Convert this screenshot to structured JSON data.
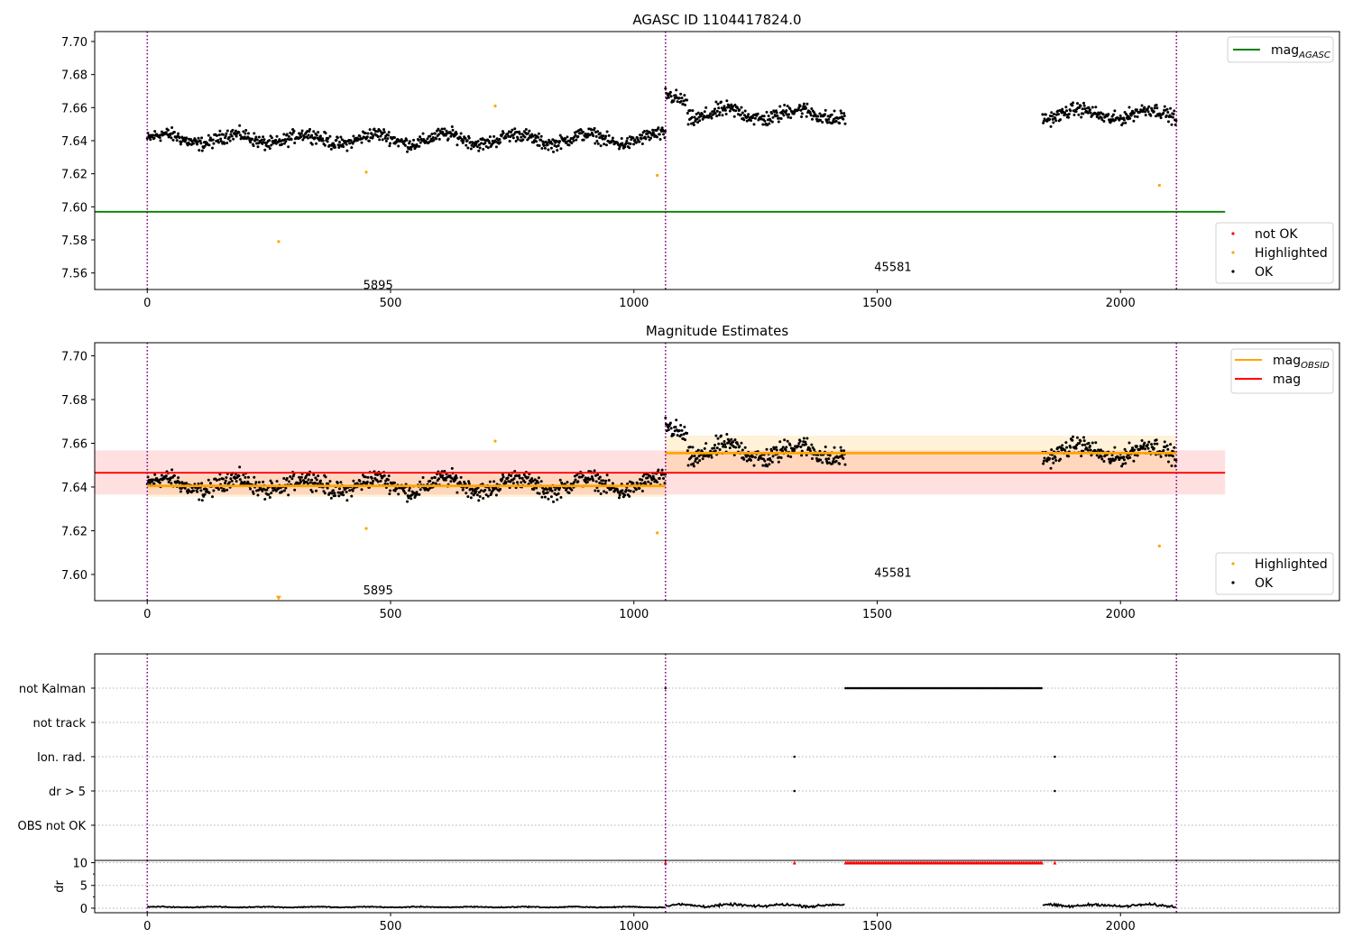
{
  "figure": {
    "title": "AGASC ID 1104417824.0"
  },
  "chart_data": [
    {
      "type": "scatter",
      "title": "",
      "xlim": [
        -108,
        2450
      ],
      "ylim": [
        7.55,
        7.706
      ],
      "xticks": [
        0,
        500,
        1000,
        1500,
        2000
      ],
      "yticks": [
        7.56,
        7.58,
        7.6,
        7.62,
        7.64,
        7.66,
        7.68,
        7.7
      ],
      "grid": false,
      "obs_boundaries": [
        0,
        1065,
        2115
      ],
      "obs_labels": [
        {
          "text": "5895",
          "x": 530,
          "y": 7.553
        },
        {
          "text": "45581",
          "x": 1588,
          "y": 7.564
        }
      ],
      "mag_agasc": {
        "value": 7.597,
        "x_range": [
          -108,
          2215
        ],
        "color": "#008000"
      },
      "legend_top": {
        "placement": "upper right",
        "entries": [
          {
            "label": "mag",
            "subscript": "AGASC",
            "color": "#008000",
            "kind": "line"
          }
        ]
      },
      "legend_bottom": {
        "placement": "lower right",
        "entries": [
          {
            "label": "not OK",
            "color": "#ff0000",
            "kind": "dot"
          },
          {
            "label": "Highlighted",
            "color": "#ffa500",
            "kind": "dot"
          },
          {
            "label": "OK",
            "color": "#000000",
            "kind": "dot"
          }
        ]
      },
      "highlighted_points": [
        [
          270,
          7.579
        ],
        [
          450,
          7.621
        ],
        [
          715,
          7.661
        ],
        [
          1048,
          7.619
        ],
        [
          2080,
          7.613
        ]
      ],
      "segments": [
        {
          "x_range": [
            0,
            1065
          ],
          "mean": 7.641,
          "amp": 0.006
        },
        {
          "x_range": [
            1065,
            1435
          ],
          "mean": 7.656,
          "amp": 0.007
        },
        {
          "x_range": [
            1840,
            2115
          ],
          "mean": 7.656,
          "amp": 0.006
        }
      ]
    },
    {
      "type": "scatter",
      "title": "Magnitude Estimates",
      "xlim": [
        -108,
        2450
      ],
      "ylim": [
        7.588,
        7.706
      ],
      "xticks": [
        0,
        500,
        1000,
        1500,
        2000
      ],
      "yticks": [
        7.6,
        7.62,
        7.64,
        7.66,
        7.68,
        7.7
      ],
      "grid": false,
      "obs_boundaries": [
        0,
        1065,
        2115
      ],
      "obs_labels": [
        {
          "text": "5895",
          "x": 530,
          "y": 7.593
        },
        {
          "text": "45581",
          "x": 1588,
          "y": 7.601
        }
      ],
      "mag": {
        "value": 7.6465,
        "band": [
          7.6365,
          7.6568
        ],
        "x_range": [
          -108,
          2215
        ],
        "color": "#ff0000"
      },
      "mag_obsid": [
        {
          "x_range": [
            0,
            1065
          ],
          "value": 7.6405,
          "band": [
            7.6355,
            7.6455
          ]
        },
        {
          "x_range": [
            1065,
            2115
          ],
          "value": 7.6555,
          "band": [
            7.6465,
            7.6635
          ]
        }
      ],
      "legend_top": {
        "placement": "upper right",
        "entries": [
          {
            "label": "mag",
            "subscript": "OBSID",
            "color": "#ffa500",
            "kind": "line"
          },
          {
            "label": "mag",
            "subscript": "",
            "color": "#ff0000",
            "kind": "line"
          }
        ]
      },
      "legend_bottom": {
        "placement": "lower right",
        "entries": [
          {
            "label": "Highlighted",
            "color": "#ffa500",
            "kind": "dot"
          },
          {
            "label": "OK",
            "color": "#000000",
            "kind": "dot"
          }
        ]
      },
      "highlighted_points": [
        [
          270,
          7.589
        ],
        [
          450,
          7.621
        ],
        [
          715,
          7.661
        ],
        [
          1048,
          7.619
        ],
        [
          2080,
          7.613
        ]
      ]
    },
    {
      "type": "scatter",
      "title": "",
      "xlim": [
        -108,
        2450
      ],
      "categories": [
        "not Kalman",
        "not track",
        "Ion. rad.",
        "dr > 5",
        "OBS not OK"
      ],
      "grid": true,
      "obs_boundaries": [
        0,
        1065,
        2115
      ],
      "flags": {
        "not Kalman": {
          "runs": [
            [
              1435,
              1840
            ]
          ],
          "points": [
            1065
          ]
        },
        "not track": {
          "runs": [],
          "points": []
        },
        "Ion. rad.": {
          "runs": [],
          "points": [
            1330,
            1865
          ]
        },
        "dr > 5": {
          "runs": [],
          "points": [
            1330,
            1865
          ]
        },
        "OBS not OK": {
          "runs": [],
          "points": []
        }
      }
    },
    {
      "type": "line",
      "title": "",
      "xlim": [
        -108,
        2450
      ],
      "ylim": [
        -1,
        10.5
      ],
      "ylabel": "dr",
      "yticks": [
        0,
        5,
        10
      ],
      "xticks": [
        0,
        500,
        1000,
        1500,
        2000
      ],
      "grid": true,
      "obs_boundaries": [
        0,
        1065,
        2115
      ],
      "clipped_points": {
        "value": 10,
        "runs": [
          [
            1435,
            1840
          ]
        ],
        "points": [
          1065,
          1330,
          1865
        ]
      },
      "segments": [
        {
          "x_range": [
            0,
            1065
          ],
          "base": 0.25,
          "amp": 0.15
        },
        {
          "x_range": [
            1065,
            1435
          ],
          "base": 0.6,
          "amp": 0.4
        },
        {
          "x_range": [
            1840,
            2115
          ],
          "base": 0.6,
          "amp": 0.4
        }
      ]
    }
  ]
}
